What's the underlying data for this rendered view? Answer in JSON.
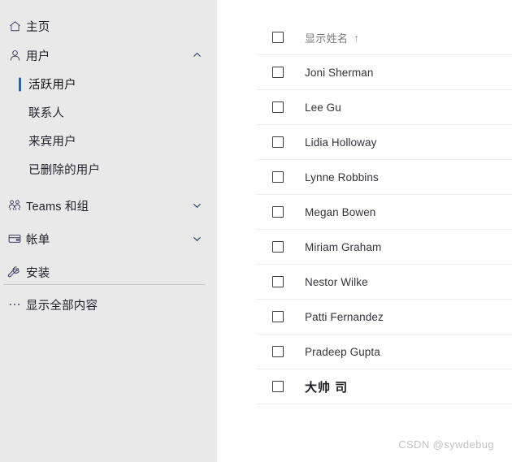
{
  "colors": {
    "sidebar_bg": "#e9e9e9",
    "content_bg": "#ffffff",
    "accent": "#1567c8",
    "divider": "#ededed",
    "watermark": "#c2c2c2"
  },
  "sidebar": {
    "items": [
      {
        "id": "home",
        "label": "主页",
        "icon": "home-icon",
        "chevron": "none",
        "type": "top"
      },
      {
        "id": "users",
        "label": "用户",
        "icon": "person-icon",
        "chevron": "up",
        "type": "top"
      },
      {
        "id": "active-users",
        "label": "活跃用户",
        "icon": "",
        "chevron": "none",
        "type": "sub",
        "active": true
      },
      {
        "id": "contacts",
        "label": "联系人",
        "icon": "",
        "chevron": "none",
        "type": "sub",
        "active": false
      },
      {
        "id": "guest-users",
        "label": "来宾用户",
        "icon": "",
        "chevron": "none",
        "type": "sub",
        "active": false
      },
      {
        "id": "deleted-users",
        "label": "已删除的用户",
        "icon": "",
        "chevron": "none",
        "type": "sub",
        "active": false
      },
      {
        "id": "teams-groups",
        "label": "Teams 和组",
        "icon": "people-icon",
        "chevron": "down",
        "type": "top"
      },
      {
        "id": "billing",
        "label": "帐单",
        "icon": "card-icon",
        "chevron": "down",
        "type": "top"
      },
      {
        "id": "setup",
        "label": "安装",
        "icon": "wrench-icon",
        "chevron": "none",
        "type": "top"
      }
    ],
    "show_all": {
      "label": "显示全部内容",
      "icon": "ellipsis-icon"
    }
  },
  "table": {
    "header": {
      "display_name": "显示姓名",
      "sort_arrow": "↑"
    },
    "rows": [
      {
        "name": "Joni Sherman",
        "checked": false,
        "cjk": false
      },
      {
        "name": "Lee Gu",
        "checked": false,
        "cjk": false
      },
      {
        "name": "Lidia Holloway",
        "checked": false,
        "cjk": false
      },
      {
        "name": "Lynne Robbins",
        "checked": false,
        "cjk": false
      },
      {
        "name": "Megan Bowen",
        "checked": false,
        "cjk": false
      },
      {
        "name": "Miriam Graham",
        "checked": false,
        "cjk": false
      },
      {
        "name": "Nestor Wilke",
        "checked": false,
        "cjk": false
      },
      {
        "name": "Patti Fernandez",
        "checked": false,
        "cjk": false
      },
      {
        "name": "Pradeep Gupta",
        "checked": false,
        "cjk": false
      },
      {
        "name": "大帅 司",
        "checked": false,
        "cjk": true
      }
    ]
  },
  "watermark": {
    "text": "CSDN @sywdebug"
  }
}
